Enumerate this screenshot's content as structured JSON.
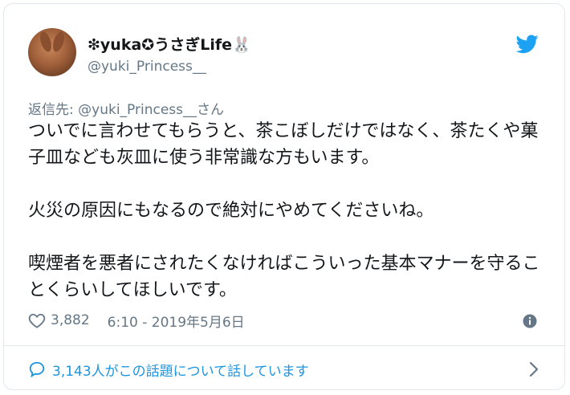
{
  "user": {
    "display_name": "❇yuka✪うさぎLife🐰",
    "handle": "@yuki_Princess__"
  },
  "reply": {
    "prefix": "返信先: ",
    "mention": "@yuki_Princess__",
    "suffix": "さん"
  },
  "tweet": {
    "text": "ついでに言わせてもらうと、茶こぼしだけではなく、茶たくや菓子皿なども灰皿に使う非常識な方もいます。\n\n火災の原因にもなるので絶対にやめてくださいね。\n\n喫煙者を悪者にされたくなければこういった基本マナーを守ることくらいしてほしいです。"
  },
  "meta": {
    "likes": "3,882",
    "timestamp": "6:10 - 2019年5月6日"
  },
  "conversation": {
    "label": "3,143人がこの話題について話しています"
  },
  "icons": {
    "brand": "twitter-bird-icon",
    "like": "heart-icon",
    "info": "info-icon",
    "conversation": "speech-bubble-icon",
    "more": "chevron-right-icon"
  },
  "colors": {
    "accent": "#1da1f2",
    "link": "#1b95e0",
    "muted": "#657786",
    "text": "#14171a",
    "border": "#e1e8ed"
  }
}
